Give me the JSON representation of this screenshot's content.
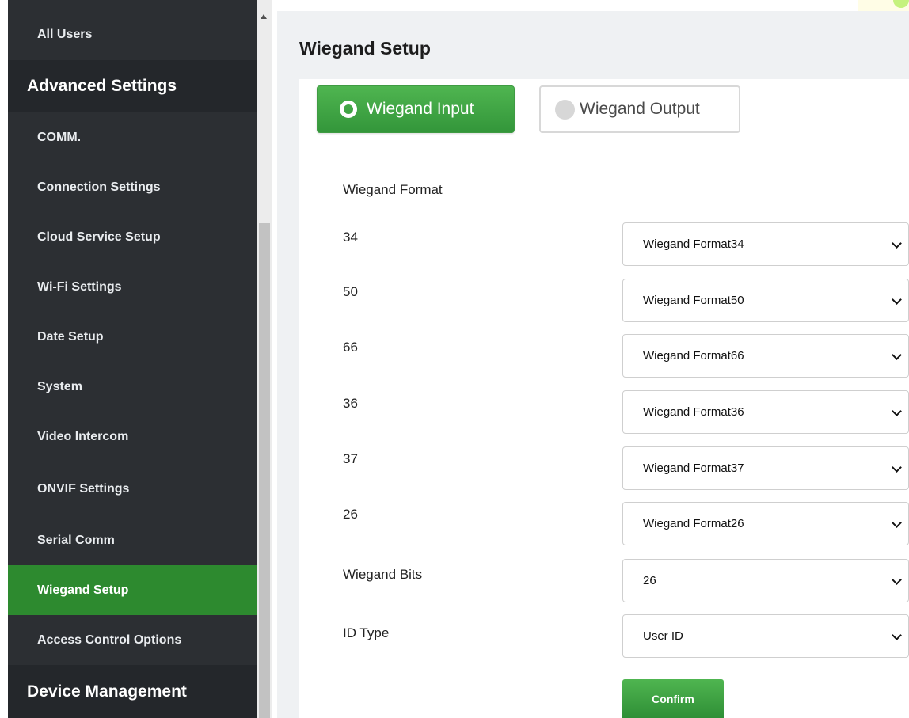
{
  "sidebar": {
    "items": [
      {
        "label": "All Users",
        "type": "sub"
      },
      {
        "label": "Advanced Settings",
        "type": "head"
      },
      {
        "label": "COMM.",
        "type": "sub"
      },
      {
        "label": "Connection Settings",
        "type": "sub"
      },
      {
        "label": "Cloud Service Setup",
        "type": "sub"
      },
      {
        "label": "Wi-Fi Settings",
        "type": "sub"
      },
      {
        "label": "Date Setup",
        "type": "sub"
      },
      {
        "label": "System",
        "type": "sub"
      },
      {
        "label": "Video Intercom",
        "type": "sub"
      },
      {
        "label": "ONVIF Settings",
        "type": "sub"
      },
      {
        "label": "Serial Comm",
        "type": "sub"
      },
      {
        "label": "Wiegand Setup",
        "type": "sub",
        "active": true
      },
      {
        "label": "Access Control Options",
        "type": "sub"
      },
      {
        "label": "Device Management",
        "type": "head"
      }
    ]
  },
  "page": {
    "title": "Wiegand Setup"
  },
  "tabs": {
    "input_label": "Wiegand Input",
    "output_label": "Wiegand Output",
    "selected": "Wiegand Input"
  },
  "form": {
    "section_label": "Wiegand Format",
    "formats": [
      {
        "label": "34",
        "value": "Wiegand Format34"
      },
      {
        "label": "50",
        "value": "Wiegand Format50"
      },
      {
        "label": "66",
        "value": "Wiegand Format66"
      },
      {
        "label": "36",
        "value": "Wiegand Format36"
      },
      {
        "label": "37",
        "value": "Wiegand Format37"
      },
      {
        "label": "26",
        "value": "Wiegand Format26"
      }
    ],
    "bits_label": "Wiegand Bits",
    "bits_value": "26",
    "id_type_label": "ID Type",
    "id_type_value": "User ID",
    "confirm_label": "Confirm"
  },
  "colors": {
    "accent": "#2d8a2f",
    "sidebar_bg": "#2c2f33",
    "sidebar_head_bg": "#24272b",
    "main_bg": "#eff1f3"
  },
  "icons": {
    "tab_input": "radio-selected-icon",
    "tab_output": "radio-unselected-icon",
    "select": "chevron-down-icon",
    "scroll": "scroll-up-arrow-icon"
  }
}
